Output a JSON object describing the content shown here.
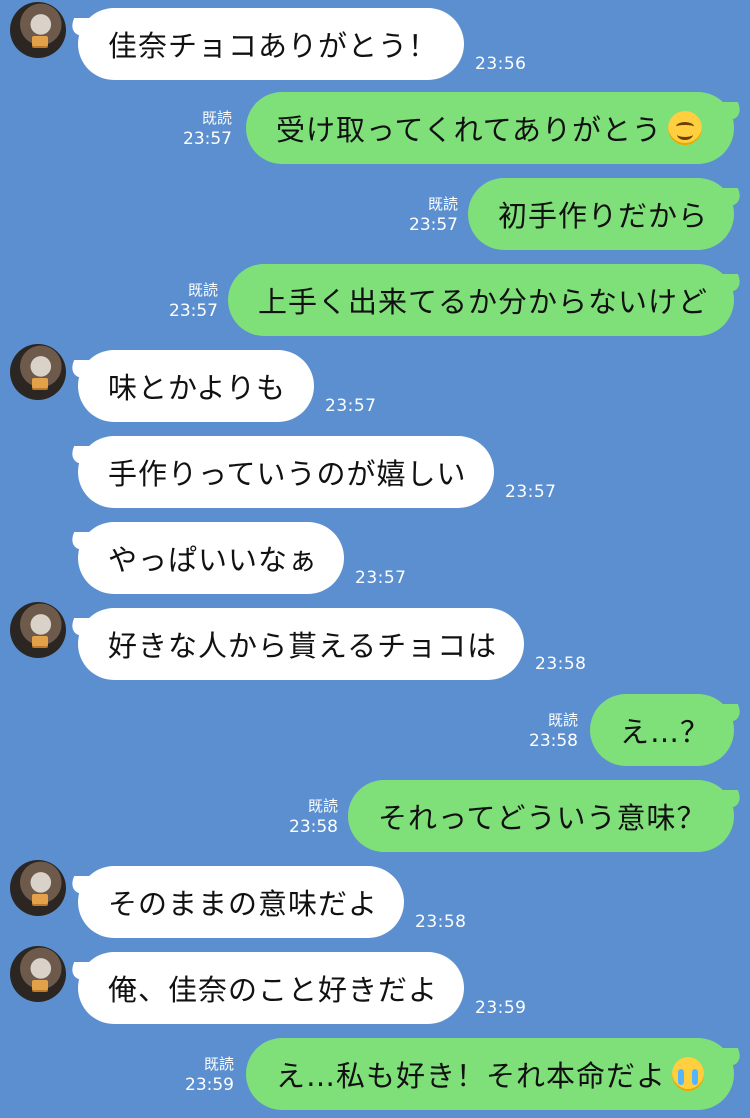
{
  "messages": [
    {
      "text": "佳奈チョコありがとう！",
      "time": "23:56"
    },
    {
      "text": "受け取ってくれてありがとう",
      "read": "既読",
      "time": "23:57",
      "emoji": "smiling-face-icon"
    },
    {
      "text": "初手作りだから",
      "read": "既読",
      "time": "23:57"
    },
    {
      "text": "上手く出来てるか分からないけど",
      "read": "既読",
      "time": "23:57"
    },
    {
      "text": "味とかよりも",
      "time": "23:57"
    },
    {
      "text": "手作りっていうのが嬉しい",
      "time": "23:57"
    },
    {
      "text": "やっぱいいなぁ",
      "time": "23:57"
    },
    {
      "text": "好きな人から貰えるチョコは",
      "time": "23:58"
    },
    {
      "text": "え…？",
      "read": "既読",
      "time": "23:58"
    },
    {
      "text": "それってどういう意味？",
      "read": "既読",
      "time": "23:58"
    },
    {
      "text": "そのままの意味だよ",
      "time": "23:58"
    },
    {
      "text": "俺、佳奈のこと好きだよ",
      "time": "23:59"
    },
    {
      "text": "え…私も好き！それ本命だよ",
      "read": "既読",
      "time": "23:59",
      "emoji": "crying-face-icon"
    }
  ],
  "colors": {
    "background": "#5b8fcf",
    "incoming_bubble": "#ffffff",
    "outgoing_bubble": "#7fe07a"
  }
}
